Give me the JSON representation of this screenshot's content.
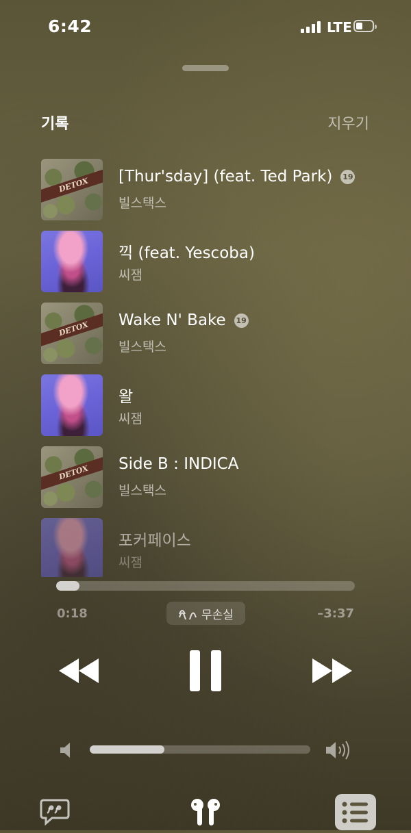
{
  "status_bar": {
    "time": "6:42",
    "network": "LTE"
  },
  "history": {
    "title": "기록",
    "clear_label": "지우기",
    "tracks": [
      {
        "title": "[Thur'sday] (feat. Ted Park)",
        "artist": "빌스택스",
        "explicit": true,
        "art": "detox"
      },
      {
        "title": "끽 (feat. Yescoba)",
        "artist": "씨잼",
        "explicit": false,
        "art": "pink-portrait"
      },
      {
        "title": "Wake N' Bake",
        "artist": "빌스택스",
        "explicit": true,
        "art": "detox"
      },
      {
        "title": "왈",
        "artist": "씨잼",
        "explicit": false,
        "art": "pink-portrait"
      },
      {
        "title": "Side B : INDICA",
        "artist": "빌스택스",
        "explicit": false,
        "art": "detox"
      },
      {
        "title": "포커페이스",
        "artist": "씨잼",
        "explicit": false,
        "art": "pink-portrait"
      }
    ],
    "explicit_badge": "19",
    "album_art_text": "DETOX"
  },
  "playback": {
    "elapsed": "0:18",
    "remaining": "–3:37",
    "progress_fraction": 0.077,
    "quality_label": "무손실",
    "volume_fraction": 0.34
  },
  "icons": {
    "transport": [
      "rewind-icon",
      "pause-icon",
      "fast-forward-icon"
    ],
    "toolbar": [
      "lyrics-icon",
      "airpods-icon",
      "queue-icon"
    ]
  },
  "colors": {
    "background": "#5f5a3f",
    "primary_text": "#ffffff"
  }
}
